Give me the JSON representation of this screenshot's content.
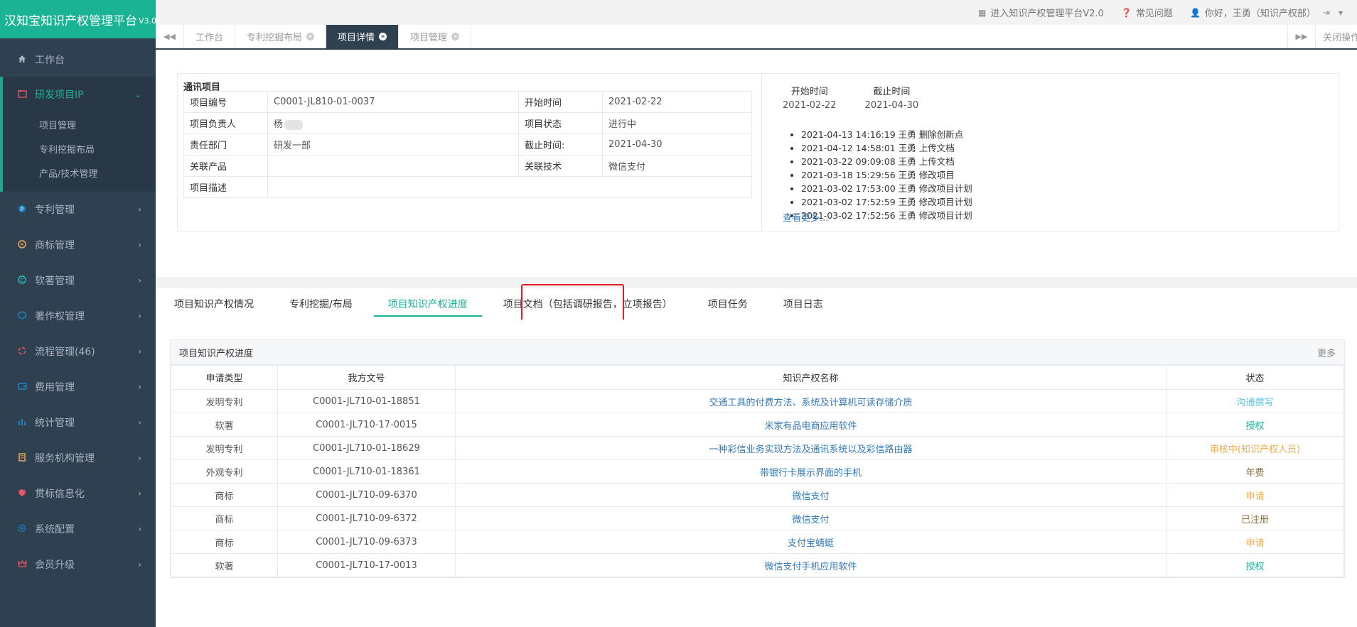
{
  "brand": {
    "title": "汉知宝知识产权管理平台",
    "version": "V3.0"
  },
  "topbar": {
    "enter_label": "进入知识产权管理平台V2.0",
    "faq_label": "常见问题",
    "user_label": "你好，王勇（知识产权部）"
  },
  "tabs": {
    "items": [
      {
        "label": "工作台"
      },
      {
        "label": "专利挖掘布局"
      },
      {
        "label": "项目详情"
      },
      {
        "label": "项目管理"
      }
    ],
    "close_ops": "关闭操作"
  },
  "sidebar": {
    "workbench": "工作台",
    "rd_project": "研发项目IP",
    "rd_sub": [
      {
        "label": "项目管理"
      },
      {
        "label": "专利挖掘布局"
      },
      {
        "label": "产品/技术管理"
      }
    ],
    "items": [
      {
        "label": "专利管理"
      },
      {
        "label": "商标管理"
      },
      {
        "label": "软著管理"
      },
      {
        "label": "著作权管理"
      },
      {
        "label": "流程管理(46)"
      },
      {
        "label": "费用管理"
      },
      {
        "label": "统计管理"
      },
      {
        "label": "服务机构管理"
      },
      {
        "label": "贯标信息化"
      },
      {
        "label": "系统配置"
      },
      {
        "label": "会员升级"
      }
    ]
  },
  "project": {
    "title": "通讯项目",
    "rows": {
      "code_label": "项目编号",
      "code": "C0001-JL810-01-0037",
      "start_label": "开始时间",
      "start": "2021-02-22",
      "owner_label": "项目负责人",
      "owner": "杨",
      "status_label": "项目状态",
      "status": "进行中",
      "dept_label": "责任部门",
      "dept": "研发一部",
      "end_label": "截止时间:",
      "end": "2021-04-30",
      "product_label": "关联产品",
      "product": "",
      "tech_label": "关联技术",
      "tech": "微信支付",
      "desc_label": "项目描述",
      "desc": ""
    }
  },
  "timeline": {
    "start_label": "开始时间",
    "start": "2021-02-22",
    "end_label": "截止时间",
    "end": "2021-04-30",
    "logs": [
      "2021-04-13 14:16:19 王勇 删除创新点",
      "2021-04-12 14:58:01 王勇 上传文档",
      "2021-03-22 09:09:08 王勇 上传文档",
      "2021-03-18 15:29:56 王勇 修改项目",
      "2021-03-02 17:53:00 王勇 修改项目计划",
      "2021-03-02 17:52:59 王勇 修改项目计划",
      "2021-03-02 17:52:56 王勇 修改项目计划"
    ],
    "more": "查看更多..."
  },
  "section_tabs": [
    {
      "label": "项目知识产权情况"
    },
    {
      "label": "专利挖掘/布局"
    },
    {
      "label": "项目知识产权进度"
    },
    {
      "label": "项目文档（包括调研报告，立项报告）"
    },
    {
      "label": "项目任务"
    },
    {
      "label": "项目日志"
    }
  ],
  "ip_progress": {
    "title": "项目知识产权进度",
    "more": "更多",
    "columns": [
      "申请类型",
      "我方文号",
      "知识产权名称",
      "状态"
    ],
    "rows": [
      {
        "type": "发明专利",
        "code": "C0001-JL710-01-18851",
        "name": "交通工具的付费方法、系统及计算机可读存储介质",
        "status": "沟通撰写",
        "color": "#5bc0de"
      },
      {
        "type": "软著",
        "code": "C0001-JL710-17-0015",
        "name": "米家有品电商应用软件",
        "status": "授权",
        "color": "#1ab394"
      },
      {
        "type": "发明专利",
        "code": "C0001-JL710-01-18629",
        "name": "一种彩信业务实现方法及通讯系统以及彩信路由器",
        "status": "审核中(知识产权人员)",
        "color": "#f0ad4e"
      },
      {
        "type": "外观专利",
        "code": "C0001-JL710-01-18361",
        "name": "带银行卡展示界面的手机",
        "status": "年费",
        "color": "#8a6d3b"
      },
      {
        "type": "商标",
        "code": "C0001-JL710-09-6370",
        "name": "微信支付",
        "status": "申请",
        "color": "#f0ad4e"
      },
      {
        "type": "商标",
        "code": "C0001-JL710-09-6372",
        "name": "微信支付",
        "status": "已注册",
        "color": "#8a6d3b"
      },
      {
        "type": "商标",
        "code": "C0001-JL710-09-6373",
        "name": "支付宝蜻蜓",
        "status": "申请",
        "color": "#f0ad4e"
      },
      {
        "type": "软著",
        "code": "C0001-JL710-17-0013",
        "name": "微信支付手机应用软件",
        "status": "授权",
        "color": "#1ab394"
      }
    ]
  },
  "icons": {
    "home": "home-icon",
    "folder": "folder-icon",
    "patent": "patent-icon",
    "trademark": "trademark-icon",
    "copyright": "copyright-icon",
    "cube": "cube-icon",
    "flow": "flow-icon",
    "wallet": "wallet-icon",
    "chart": "bar-chart-icon",
    "building": "building-icon",
    "shield": "shield-icon",
    "gear": "gear-icon",
    "crown": "crown-icon"
  }
}
